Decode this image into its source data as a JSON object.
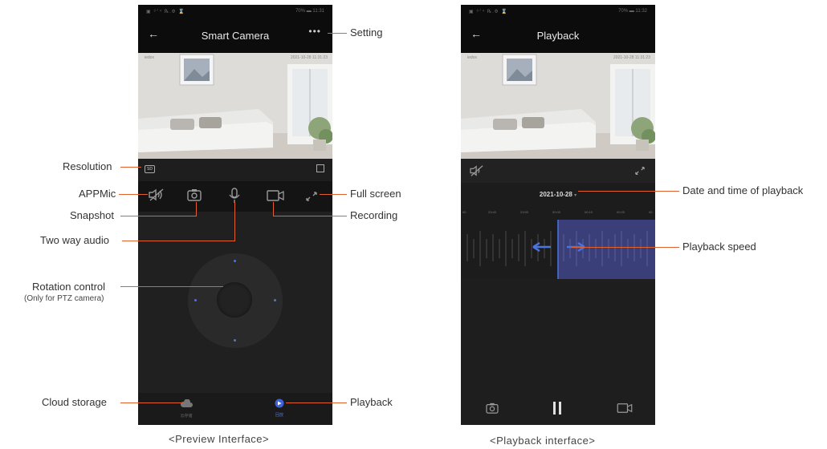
{
  "preview": {
    "status_left": "▣ ⁹ᐟ⁴ ℞.Ф ⌛",
    "status_right": "70% ▬ 11:31",
    "title": "Smart Camera",
    "watermark_left": "iedox",
    "watermark_right": "2021-10-28 11:31:23",
    "res_badge": "SD",
    "bottom_cloud_label": "云存储",
    "bottom_playback_label": "回放",
    "caption": "<Preview Interface>"
  },
  "playback": {
    "status_left": "▣ ⁹ᐟ⁴ ℞.Ф ⌛",
    "status_right": "70% ▬ 11:32",
    "title": "Playback",
    "watermark_left": "iedox",
    "watermark_right": "2021-10-28 11:31:23",
    "date": "2021-10-28",
    "timeline_ticks": [
      "00",
      "23:40",
      "23:50",
      "00:00",
      "00:10",
      "00:20",
      "00"
    ],
    "caption": "<Playback interface>"
  },
  "callouts": {
    "setting": "Setting",
    "resolution": "Resolution",
    "appmic": "APPMic",
    "full_screen": "Full screen",
    "snapshot": "Snapshot",
    "recording": "Recording",
    "two_way_audio": "Two way audio",
    "rotation_control": "Rotation control",
    "rotation_note": "(Only for PTZ camera)",
    "cloud_storage": "Cloud storage",
    "playback": "Playback",
    "date_time": "Date and time of playback",
    "playback_speed": "Playback speed"
  },
  "colors": {
    "callout_line": "#e06030",
    "timeline_highlight": "#3a3f7a",
    "timeline_cursor": "#4a74e0"
  }
}
